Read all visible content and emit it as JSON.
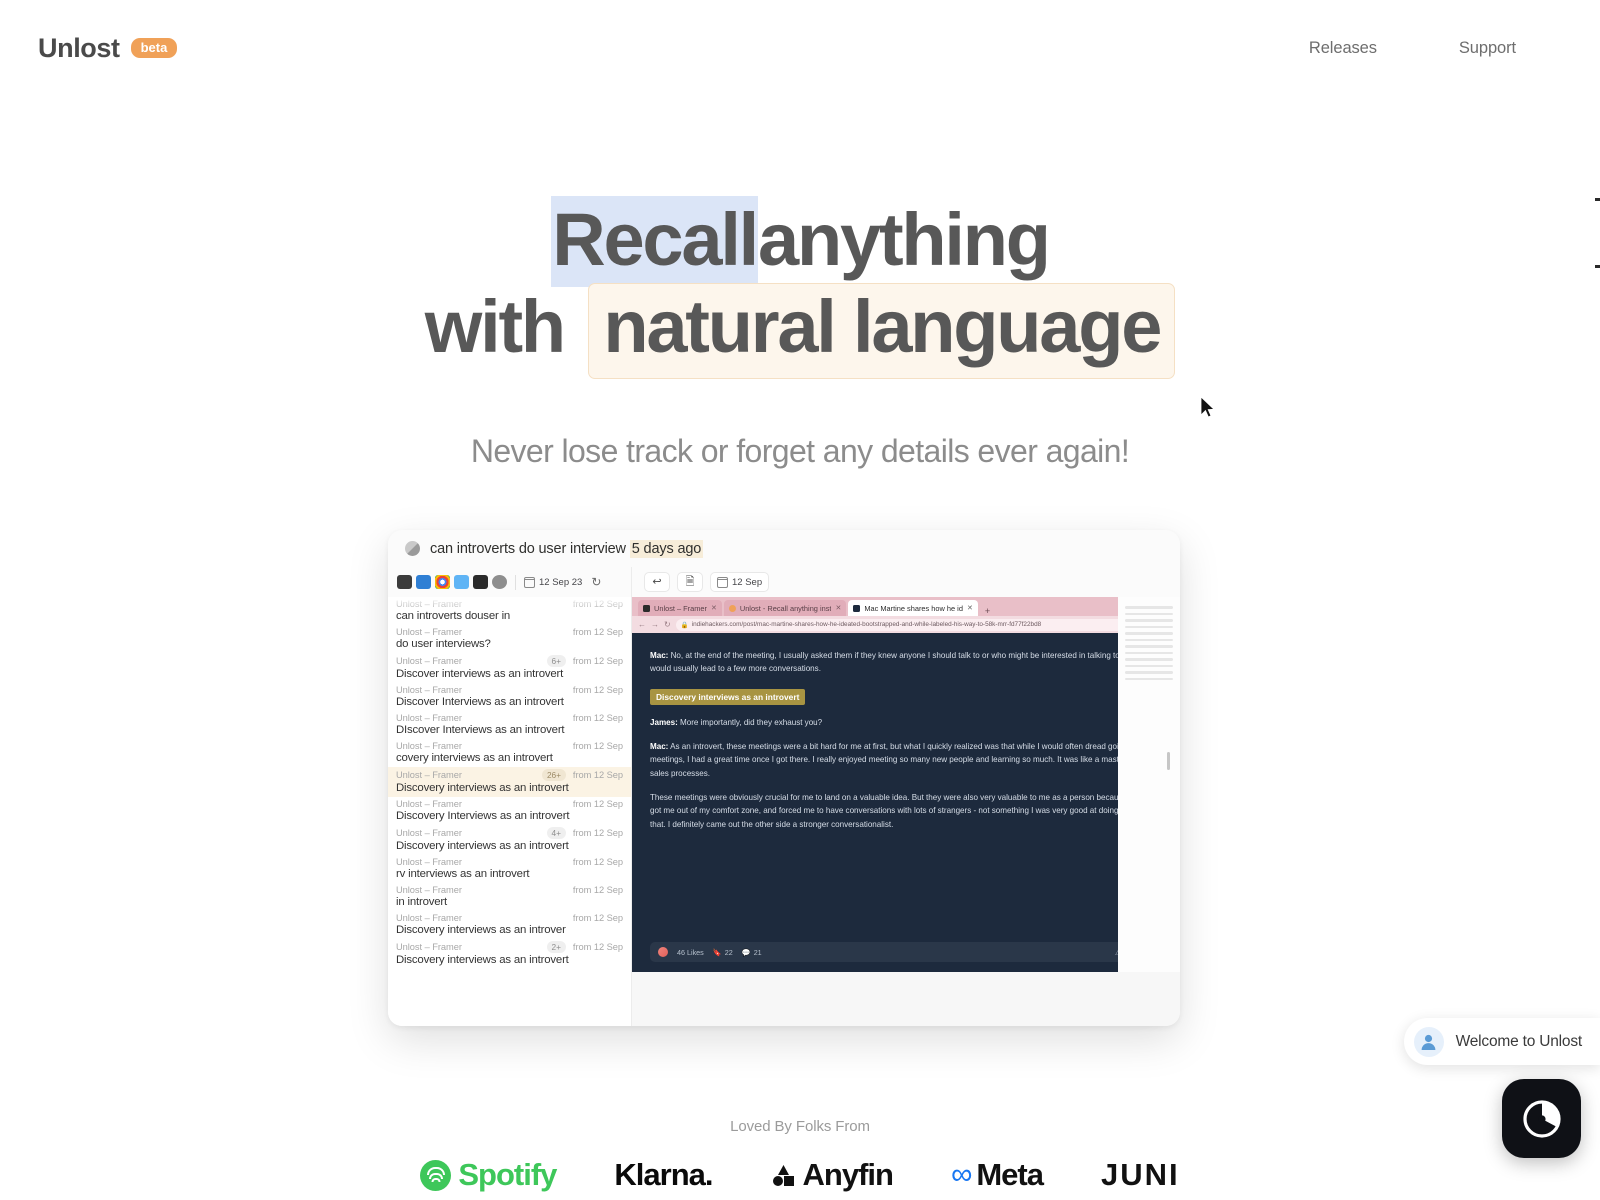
{
  "header": {
    "brand_name": "Unlost",
    "badge": "beta",
    "nav": [
      {
        "label": "Releases"
      },
      {
        "label": "Support"
      }
    ]
  },
  "hero": {
    "line1_selected": "Recall",
    "line1_rest": "anything",
    "line2_prefix": "with",
    "line2_boxed": "natural language",
    "subheadline": "Never lose track or forget any details ever again!",
    "selection_color": "#dbe5f7",
    "box_background": "#fdf6ec",
    "box_border": "#f5e0c4"
  },
  "app": {
    "search": {
      "query": "can introverts do user interview",
      "time_filter": "5 days ago"
    },
    "toolbar": {
      "icons": [
        "video-camera-icon",
        "vscode-icon",
        "chrome-icon",
        "mail-icon",
        "terminal-icon",
        "settings-icon"
      ],
      "date_label": "12 Sep 23",
      "refresh_icon": "refresh-icon"
    },
    "preview_toolbar": {
      "back_icon": "return-arrow-icon",
      "doc_icon": "document-icon",
      "date_label": "12 Sep"
    },
    "results": [
      {
        "source": "Unlost – Framer",
        "from": "from 12 Sep",
        "count": "",
        "title": "can introverts douser in",
        "highlighted": false
      },
      {
        "source": "Unlost – Framer",
        "from": "from 12 Sep",
        "count": "",
        "title": "do user interviews?",
        "highlighted": false
      },
      {
        "source": "Unlost – Framer",
        "from": "from 12 Sep",
        "count": "6+",
        "title": "Discover interviews as an introvert",
        "highlighted": false
      },
      {
        "source": "Unlost – Framer",
        "from": "from 12 Sep",
        "count": "",
        "title": "Discover Interviews as an introvert",
        "highlighted": false
      },
      {
        "source": "Unlost – Framer",
        "from": "from 12 Sep",
        "count": "",
        "title": "DIscover Interviews as an introvert",
        "highlighted": false
      },
      {
        "source": "Unlost – Framer",
        "from": "from 12 Sep",
        "count": "",
        "title": "covery interviews as an introvert",
        "highlighted": false
      },
      {
        "source": "Unlost – Framer",
        "from": "from 12 Sep",
        "count": "26+",
        "title": "Discovery interviews as an introvert",
        "highlighted": true
      },
      {
        "source": "Unlost – Framer",
        "from": "from 12 Sep",
        "count": "",
        "title": "Discovery Interviews as an introvert",
        "highlighted": false
      },
      {
        "source": "Unlost – Framer",
        "from": "from 12 Sep",
        "count": "4+",
        "title": "Discovery interviews as an introvert",
        "highlighted": false
      },
      {
        "source": "Unlost – Framer",
        "from": "from 12 Sep",
        "count": "",
        "title": "rv interviews as an introvert",
        "highlighted": false
      },
      {
        "source": "Unlost – Framer",
        "from": "from 12 Sep",
        "count": "",
        "title": "in introvert",
        "highlighted": false
      },
      {
        "source": "Unlost – Framer",
        "from": "from 12 Sep",
        "count": "",
        "title": "Discovery interviews as an introver",
        "highlighted": false
      },
      {
        "source": "Unlost – Framer",
        "from": "from 12 Sep",
        "count": "2+",
        "title": "Discovery interviews as an introvert",
        "highlighted": false
      }
    ],
    "browser": {
      "tabs": [
        {
          "label": "Unlost – Framer",
          "active": false
        },
        {
          "label": "Unlost - Recall anything inst",
          "active": false
        },
        {
          "label": "Mac Martine shares how he id",
          "active": true
        }
      ],
      "new_tab": "+",
      "url": "indiehackers.com/post/mac-martine-shares-how-he-ideated-bootstrapped-and-while-labeled-his-way-to-58k-mrr-fd77f22bd8",
      "tabstrip_color": "#e9bfc8"
    },
    "article": {
      "paragraphs": [
        {
          "speaker": "Mac:",
          "text": " No, at the end of the meeting, I usually asked them if they knew anyone I should talk to or who might be interested in talking to me. This would usually lead to a few more conversations."
        },
        {
          "speaker": "James:",
          "text": " More importantly, did they exhaust you?"
        },
        {
          "speaker": "Mac:",
          "text": " As an introvert, these meetings were a bit hard for me at first, but what I quickly realized was that while I would often dread going to the meetings, I had a great time once I got there. I really enjoyed meeting so many new people and learning so much. It was like a masterclass in sales processes."
        },
        {
          "speaker": "",
          "text": "These meetings were obviously crucial for me to land on a valuable idea. But they were also very valuable to me as a person because they got me out of my comfort zone, and forced me to have conversations with lots of strangers - not something I was very good at doing prior to that. I definitely came out the other side a stronger conversationalist."
        }
      ],
      "highlight": "Discovery interviews as an introvert",
      "highlight_color": "#a89442",
      "background": "#1d2a3d",
      "actions": {
        "likes": "46 Likes",
        "bookmarks": "22",
        "comments": "21",
        "report": "Report"
      }
    }
  },
  "logos": {
    "caption": "Loved By Folks From",
    "items": [
      {
        "name": "Spotify",
        "color": "#3ec75a"
      },
      {
        "name": "Klarna.",
        "color": "#0a0a0a"
      },
      {
        "name": "Anyfin",
        "color": "#111111"
      },
      {
        "name": "Meta",
        "color": "#1877f2"
      },
      {
        "name": "JUNI",
        "color": "#111111"
      }
    ]
  },
  "chat": {
    "greeting": "Welcome to Unlost",
    "avatar_icon": "user-avatar-icon",
    "fab_icon": "chat-launcher-icon"
  }
}
